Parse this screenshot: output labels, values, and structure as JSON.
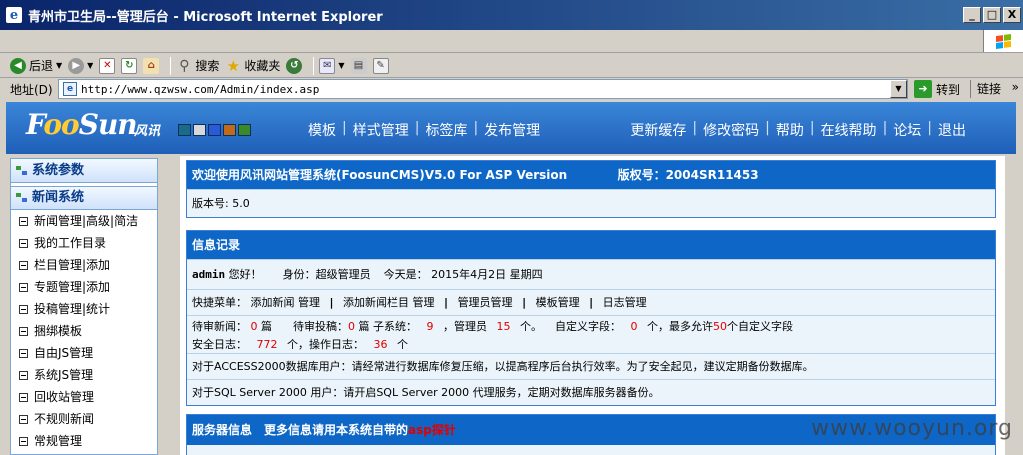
{
  "window": {
    "title": "青州市卫生局--管理后台 - Microsoft Internet Explorer",
    "buttons": {
      "minimize": "_",
      "maximize": "□",
      "close": "X"
    }
  },
  "toolbar": {
    "back": "后退",
    "search": "搜索",
    "favorites": "收藏夹"
  },
  "address_bar": {
    "label": "地址(D)",
    "url": "http://www.qzwsw.com/Admin/index.asp",
    "go": "转到",
    "links": "链接"
  },
  "site_header": {
    "logo_text_pre": "F",
    "logo_text_mid": "oo",
    "logo_text_post": "Sun",
    "logo_cn": "风讯",
    "swatches": [
      "#1a6a8a",
      "#d8d8d8",
      "#2a5ad8",
      "#c06a1a",
      "#3a8a2a"
    ],
    "nav_left": [
      "模板",
      "样式管理",
      "标签库",
      "发布管理"
    ],
    "nav_right": [
      "更新缓存",
      "修改密码",
      "帮助",
      "在线帮助",
      "论坛",
      "退出"
    ],
    "separator": "|"
  },
  "sidebar": {
    "sections": [
      "系统参数",
      "新闻系统"
    ],
    "items": [
      "新闻管理|高级|简洁",
      "我的工作目录",
      "栏目管理|添加",
      "专题管理|添加",
      "投稿管理|统计",
      "捆绑模板",
      "自由JS管理",
      "系统JS管理",
      "回收站管理",
      "不规则新闻",
      "常规管理"
    ]
  },
  "welcome_panel": {
    "title": "欢迎使用风讯网站管理系统(FoosunCMS)V5.0 For ASP Version",
    "copyright": "版权号：2004SR11453",
    "version": "版本号: 5.0"
  },
  "info_panel": {
    "title": "信息记录",
    "user": "admin",
    "greeting": "您好！",
    "identity": "身份：超级管理员",
    "today": "今天是： 2015年4月2日 星期四",
    "quick_label": "快捷菜单：",
    "quick_items": [
      "添加新闻 管理",
      "添加新闻栏目 管理",
      "管理员管理",
      "模板管理",
      "日志管理"
    ],
    "quick_sep": "|",
    "pending_news_label": "待审新闻：",
    "pending_news": "0",
    "pending_news_unit": "篇",
    "pending_contrib_label": "待审投稿：",
    "pending_contrib": "0",
    "pending_contrib_unit": "篇",
    "subsystems_label": "子系统：",
    "subsystems": "9",
    "admins_label": "，管理员",
    "admins": "15",
    "admins_unit": "个。",
    "custom_fields_label": "自定义字段：",
    "custom_fields": "0",
    "custom_fields_mid": "个，最多允许",
    "custom_fields_max": "50",
    "custom_fields_tail": "个自定义字段",
    "security_log_label": "安全日志：",
    "security_log": "772",
    "ops_log_label": "个，操作日志：",
    "ops_log": "36",
    "ops_log_unit": "个",
    "access_note": "对于ACCESS2000数据库用户：请经常进行数据库修复压缩，以提高程序后台执行效率。为了安全起见，建议定期备份数据库。",
    "sql_note": "对于SQL Server 2000 用户：请开启SQL Server 2000 代理服务，定期对数据库服务器备份。"
  },
  "server_panel": {
    "title": "服务器信息　更多信息请用本系统自带的",
    "probe": "asp探针"
  },
  "watermark": "www.wooyun.org"
}
